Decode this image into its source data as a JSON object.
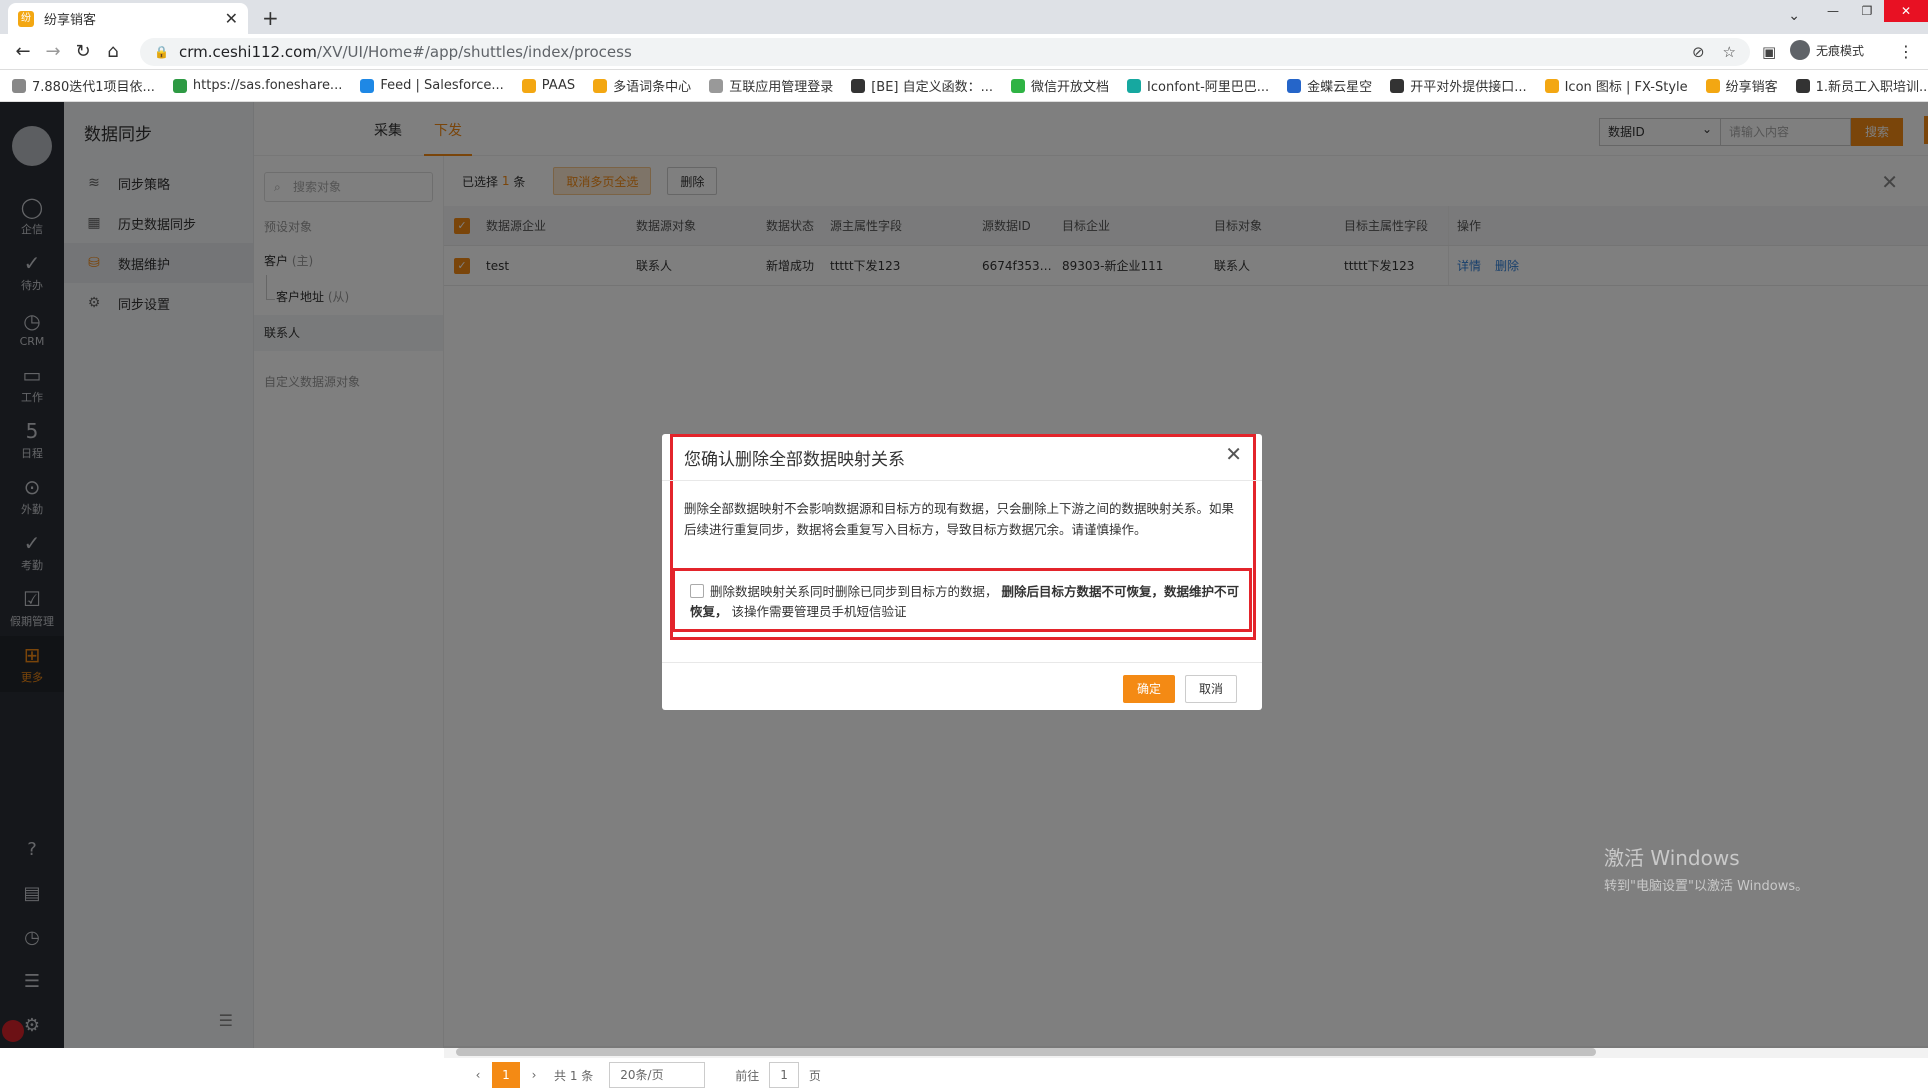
{
  "browser": {
    "tab_title": "纷享销客",
    "url_host": "crm.ceshi112.com",
    "url_path": "/XV/UI/Home#/app/shuttles/index/process",
    "profile_label": "无痕模式",
    "bookmarks": [
      {
        "label": "7.880迭代1项目依...",
        "color": "#888888"
      },
      {
        "label": "https://sas.foneshare...",
        "color": "#2e9a44"
      },
      {
        "label": "Feed | Salesforce...",
        "color": "#1e88e5"
      },
      {
        "label": "PAAS",
        "color": "#f3a712"
      },
      {
        "label": "多语词条中心",
        "color": "#f3a712"
      },
      {
        "label": "互联应用管理登录",
        "color": "#999999"
      },
      {
        "label": "[BE] 自定义函数：...",
        "color": "#333333"
      },
      {
        "label": "微信开放文档",
        "color": "#2fb344"
      },
      {
        "label": "Iconfont-阿里巴巴...",
        "color": "#16a8a0"
      },
      {
        "label": "金蝶云星空",
        "color": "#2565c9"
      },
      {
        "label": "开平对外提供接口...",
        "color": "#333333"
      },
      {
        "label": "Icon 图标 | FX-Style",
        "color": "#f3a712"
      },
      {
        "label": "纷享销客",
        "color": "#f3a712"
      },
      {
        "label": "1.新员工入职培训...",
        "color": "#333333"
      }
    ]
  },
  "rail": {
    "items": [
      {
        "label": "企信",
        "icon": "chat-icon",
        "glyph": "◯"
      },
      {
        "label": "待办",
        "icon": "todo-icon",
        "glyph": "✓"
      },
      {
        "label": "CRM",
        "icon": "crm-icon",
        "glyph": "◷"
      },
      {
        "label": "工作",
        "icon": "work-icon",
        "glyph": "▭"
      },
      {
        "label": "日程",
        "icon": "calendar-icon",
        "glyph": "5"
      },
      {
        "label": "外勤",
        "icon": "location-icon",
        "glyph": "⊙"
      },
      {
        "label": "考勤",
        "icon": "attendance-icon",
        "glyph": "✓"
      },
      {
        "label": "假期管理",
        "icon": "leave-icon",
        "glyph": "☑"
      },
      {
        "label": "更多",
        "icon": "grid-icon",
        "glyph": "⊞"
      }
    ]
  },
  "sidebar": {
    "title": "数据同步",
    "items": [
      {
        "label": "同步策略",
        "icon": "layers-icon",
        "glyph": "≋"
      },
      {
        "label": "历史数据同步",
        "icon": "history-icon",
        "glyph": "▦"
      },
      {
        "label": "数据维护",
        "icon": "database-icon",
        "glyph": "⛁"
      },
      {
        "label": "同步设置",
        "icon": "gear-icon",
        "glyph": "⚙"
      }
    ]
  },
  "topbar": {
    "tabs": [
      "采集",
      "下发"
    ],
    "filter_select": "数据ID",
    "filter_placeholder": "请输入内容",
    "search_label": "搜索"
  },
  "objects": {
    "search_placeholder": "搜索对象",
    "preset_label": "预设对象",
    "items": [
      {
        "label": "客户",
        "tag": "(主)"
      },
      {
        "label": "客户地址",
        "tag": "(从)"
      },
      {
        "label": "联系人",
        "tag": ""
      }
    ],
    "custom_label": "自定义数据源对象"
  },
  "toolbar": {
    "selected_prefix": "已选择",
    "selected_count": "1",
    "selected_suffix": "条",
    "cancel_all_label": "取消多页全选",
    "delete_label": "删除"
  },
  "table": {
    "headers": [
      "数据源企业",
      "数据源对象",
      "数据状态",
      "源主属性字段",
      "源数据ID",
      "目标企业",
      "目标对象",
      "目标主属性字段",
      "操作"
    ],
    "rows": [
      {
        "cells": [
          "test",
          "联系人",
          "新增成功",
          "ttttt下发123",
          "6674f353da1...",
          "89303-新企业111",
          "联系人",
          "ttttt下发123"
        ],
        "actions": [
          "详情",
          "删除"
        ]
      }
    ]
  },
  "pager": {
    "current": "1",
    "total": "共 1 条",
    "page_size": "20条/页",
    "goto_label": "前往",
    "goto_value": "1",
    "page_suffix": "页"
  },
  "watermark": {
    "line1": "激活 Windows",
    "line2": "转到\"电脑设置\"以激活 Windows。"
  },
  "dialog": {
    "title": "您确认删除全部数据映射关系",
    "message": "删除全部数据映射不会影响数据源和目标方的现有数据，只会删除上下游之间的数据映射关系。如果后续进行重复同步，数据将会重复写入目标方，导致目标方数据冗余。请谨慎操作。",
    "check_text": "删除数据映射关系同时删除已同步到目标方的数据，",
    "check_bold": "删除后目标方数据不可恢复，数据维护不可恢复，",
    "check_tail": "该操作需要管理员手机短信验证",
    "ok_label": "确定",
    "cancel_label": "取消"
  }
}
